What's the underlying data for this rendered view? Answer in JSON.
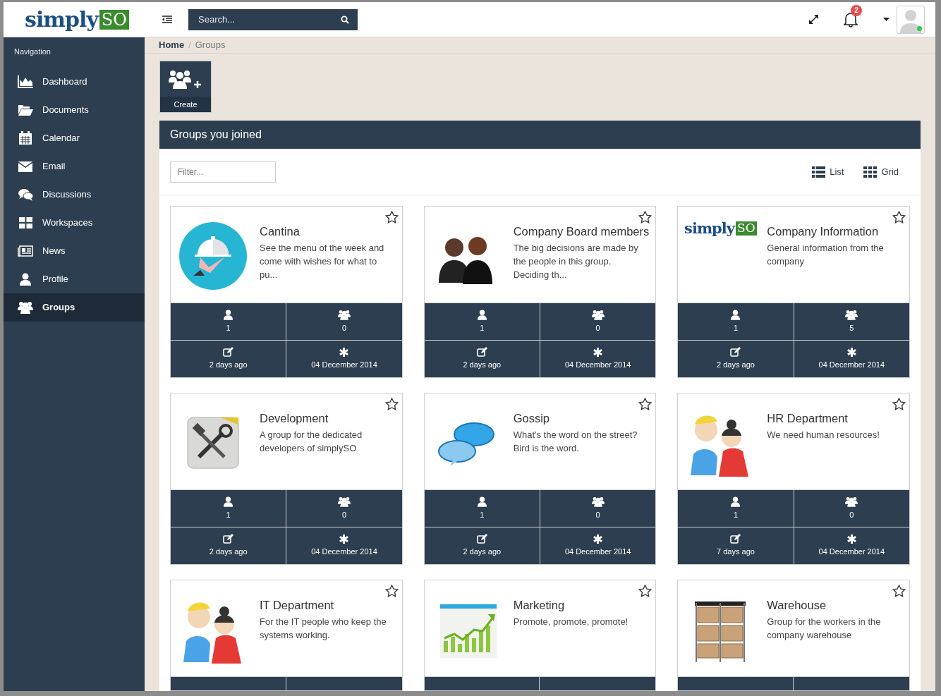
{
  "header": {
    "logo": {
      "word": "simply",
      "badge": "SO"
    },
    "search": {
      "placeholder": "Search..."
    },
    "notifications": "2",
    "online": true
  },
  "sidebar": {
    "title": "Navigation",
    "items": [
      {
        "label": "Dashboard",
        "selected": false
      },
      {
        "label": "Documents",
        "selected": false
      },
      {
        "label": "Calendar",
        "selected": false
      },
      {
        "label": "Email",
        "selected": false
      },
      {
        "label": "Discussions",
        "selected": false
      },
      {
        "label": "Workspaces",
        "selected": false
      },
      {
        "label": "News",
        "selected": false
      },
      {
        "label": "Profile",
        "selected": false
      },
      {
        "label": "Groups",
        "selected": true
      }
    ]
  },
  "breadcrumb": {
    "items": [
      {
        "label": "Home",
        "current": false
      },
      {
        "label": "Groups",
        "current": true
      }
    ],
    "separator": "/"
  },
  "create_button": "Create",
  "panel": {
    "title": "Groups you joined",
    "filter": {
      "placeholder": "Filter..."
    },
    "views": [
      {
        "label": "List"
      },
      {
        "label": "Grid"
      }
    ],
    "groups": [
      {
        "name": "Cantina",
        "description": "See the menu of the week and come with wishes for what to pu...",
        "kind": "cloche",
        "starred": false,
        "stats": {
          "members": "1",
          "subgroups": "0",
          "updated": "2 days ago",
          "created": "04 December 2014"
        }
      },
      {
        "name": "Company Board members",
        "description": "The big decisions are made by the people in this group. Deciding th...",
        "kind": "people",
        "starred": false,
        "stats": {
          "members": "1",
          "subgroups": "0",
          "updated": "2 days ago",
          "created": "04 December 2014"
        }
      },
      {
        "name": "Company Information",
        "description": "General information from the company",
        "kind": "logo",
        "logo": {
          "word": "simply",
          "badge": "SO"
        },
        "starred": false,
        "stats": {
          "members": "1",
          "subgroups": "5",
          "updated": "2 days ago",
          "created": "04 December 2014"
        }
      },
      {
        "name": "Development",
        "description": "A group for the dedicated developers of simplySO",
        "kind": "tools",
        "starred": false,
        "stats": {
          "members": "1",
          "subgroups": "0",
          "updated": "2 days ago",
          "created": "04 December 2014"
        }
      },
      {
        "name": "Gossip",
        "description": "What's the word on the street? Bird is the word.",
        "kind": "bubbles",
        "starred": false,
        "stats": {
          "members": "1",
          "subgroups": "0",
          "updated": "2 days ago",
          "created": "04 December 2014"
        }
      },
      {
        "name": "HR Department",
        "description": "We need human resources!",
        "kind": "couple",
        "starred": false,
        "stats": {
          "members": "1",
          "subgroups": "0",
          "updated": "7 days ago",
          "created": "04 December 2014"
        }
      },
      {
        "name": "IT Department",
        "description": "For the IT people who keep the systems working.",
        "kind": "couple",
        "starred": false
      },
      {
        "name": "Marketing",
        "description": "Promote, promote, promote!",
        "kind": "chart",
        "starred": false
      },
      {
        "name": "Warehouse",
        "description": "Group for the workers in the company warehouse",
        "kind": "boxes",
        "starred": false
      }
    ]
  }
}
